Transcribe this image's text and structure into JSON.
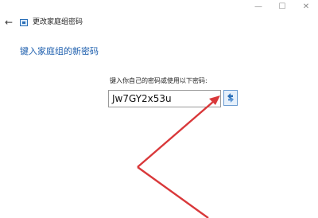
{
  "window": {
    "title": "更改家庭组密码",
    "back_icon": "back-arrow-icon",
    "app_icon": "homegroup-icon",
    "controls": {
      "minimize": "—",
      "maximize": "☐",
      "close": "✕"
    }
  },
  "main": {
    "heading": "键入家庭组的新密码",
    "prompt": "键入你自己的密码或使用以下密码:",
    "password_value": "Jw7GY2x53u",
    "regenerate_icon": "refresh-arrows-icon"
  },
  "colors": {
    "heading": "#1e5fae",
    "annotation_arrow": "#d9383a"
  }
}
